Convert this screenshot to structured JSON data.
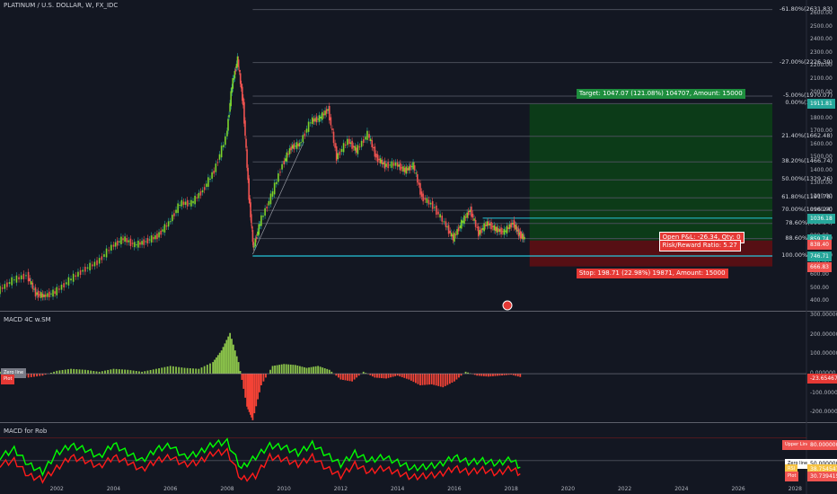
{
  "title": "PLATINUM / U.S. DOLLAR, W, FX_IDC",
  "panels": {
    "macd1_title": "MACD 4C w.SM",
    "macd2_title": "MACD for Rob"
  },
  "chart_data": [
    {
      "type": "line",
      "subtype": "candlestick",
      "title": "PLATINUM / U.S. DOLLAR, W, FX_IDC",
      "x_ticks": [
        "2002",
        "2004",
        "2006",
        "2008",
        "2010",
        "2012",
        "2014",
        "2016",
        "2018",
        "2020",
        "2022",
        "2024",
        "2026",
        "2028"
      ],
      "y_ticks": [
        300,
        400,
        500,
        600,
        700,
        800,
        900,
        1000,
        1100,
        1200,
        1300,
        1400,
        1500,
        1600,
        1700,
        1800,
        1900,
        2000,
        2100,
        2200,
        2300,
        2400,
        2500,
        2600
      ],
      "ylim": [
        300,
        2650
      ],
      "series": [
        {
          "x": [
            2000.0,
            2000.5,
            2001.0,
            2001.3,
            2001.6,
            2002.0,
            2002.5,
            2003.0,
            2003.5,
            2004.0,
            2004.4,
            2004.8,
            2005.2,
            2005.6,
            2006.0,
            2006.4,
            2006.8,
            2007.2,
            2007.6,
            2008.0,
            2008.2,
            2008.4,
            2008.6,
            2008.8,
            2008.95,
            2009.2,
            2009.6,
            2010.0,
            2010.3,
            2010.6,
            2011.0,
            2011.3,
            2011.6,
            2011.9,
            2012.3,
            2012.6,
            2013.0,
            2013.3,
            2013.6,
            2014.0,
            2014.3,
            2014.6,
            2014.9,
            2015.3,
            2015.7,
            2016.0,
            2016.3,
            2016.6,
            2016.9,
            2017.2,
            2017.5,
            2017.8,
            2018.1,
            2018.3,
            2018.5
          ],
          "values": [
            480,
            560,
            600,
            460,
            440,
            470,
            560,
            640,
            700,
            820,
            880,
            830,
            860,
            900,
            1000,
            1150,
            1150,
            1250,
            1400,
            1650,
            2050,
            2250,
            1900,
            1200,
            800,
            1000,
            1200,
            1450,
            1580,
            1600,
            1780,
            1800,
            1870,
            1500,
            1630,
            1550,
            1680,
            1500,
            1440,
            1450,
            1400,
            1440,
            1200,
            1130,
            1000,
            880,
            1000,
            1100,
            920,
            1000,
            950,
            930,
            1000,
            920,
            880
          ]
        }
      ],
      "fibonacci_levels": [
        {
          "label": "-61.80%(2631.83)",
          "value": 2631.83
        },
        {
          "label": "-27.00%(2226.39)",
          "value": 2226.39
        },
        {
          "label": "-5.00%(1970.07)",
          "value": 1970.07
        },
        {
          "label": "0.00%(1911.81)",
          "value": 1911.81
        },
        {
          "label": "21.40%(1662.48)",
          "value": 1662.48
        },
        {
          "label": "38.20%(1466.74)",
          "value": 1466.74
        },
        {
          "label": "50.00%(1329.26)",
          "value": 1329.26
        },
        {
          "label": "61.80%(1191.78)",
          "value": 1191.78
        },
        {
          "label": "70.00%(1096.24)",
          "value": 1096.24
        },
        {
          "label": "78.60%(996.04)",
          "value": 996.04
        },
        {
          "label": "88.60%(879.53)",
          "value": 879.53
        },
        {
          "label": "100.00%(746.71)",
          "value": 746.71
        }
      ],
      "position": {
        "target_label": "Target: 1047.07 (121.08%) 104707, Amount: 15000",
        "stop_label": "Stop: 198.71 (22.98%) 19871, Amount: 15000",
        "pnl_label": "Open P&L: -26.34, Qty: 0",
        "rr_label": "Risk/Reward Ratio: 5.27",
        "entry": 865,
        "target": 1911.81,
        "stop": 666.83
      },
      "price_tags": [
        {
          "text": "1911.81",
          "value": 1911.81,
          "color": "#26a69a"
        },
        {
          "text": "1036.18",
          "value": 1036.18,
          "color": "#26a69a"
        },
        {
          "text": "859.74",
          "value": 880,
          "color": "#26a69a"
        },
        {
          "text": "838.40",
          "value": 838.4,
          "color": "#ef5350"
        },
        {
          "text": "746.71",
          "value": 746.71,
          "color": "#26a69a"
        },
        {
          "text": "666.83",
          "value": 666.83,
          "color": "#ef5350"
        }
      ]
    },
    {
      "type": "bar",
      "title": "MACD 4C w.SM",
      "y_ticks": [
        {
          "label": "300.000000",
          "value": 300
        },
        {
          "label": "200.000000",
          "value": 200
        },
        {
          "label": "100.000000",
          "value": 100
        },
        {
          "label": "0.000000",
          "value": 0
        },
        {
          "label": "-100.000000",
          "value": -100
        },
        {
          "label": "-200.000000",
          "value": -200
        }
      ],
      "ylim": [
        -250,
        320
      ],
      "series": [
        {
          "name": "histogram",
          "x": [
            2000,
            2000.5,
            2001,
            2001.5,
            2002,
            2002.5,
            2003,
            2003.5,
            2004,
            2004.5,
            2005,
            2005.5,
            2006,
            2006.5,
            2007,
            2007.5,
            2007.8,
            2008.1,
            2008.4,
            2008.7,
            2008.9,
            2009.2,
            2009.6,
            2010,
            2010.4,
            2010.8,
            2011.2,
            2011.6,
            2012,
            2012.4,
            2012.8,
            2013.2,
            2013.6,
            2014,
            2014.4,
            2014.8,
            2015.2,
            2015.6,
            2016,
            2016.4,
            2016.8,
            2017.2,
            2017.6,
            2018,
            2018.4
          ],
          "values": [
            10,
            15,
            -20,
            -10,
            15,
            25,
            20,
            10,
            25,
            20,
            10,
            25,
            40,
            30,
            25,
            60,
            120,
            210,
            60,
            -170,
            -240,
            -60,
            40,
            50,
            45,
            30,
            40,
            20,
            -30,
            -40,
            10,
            -20,
            -25,
            -10,
            -30,
            -60,
            -55,
            -70,
            -40,
            10,
            -10,
            -15,
            -10,
            -5,
            -20
          ]
        }
      ],
      "zero_label": "Zero line",
      "last_label": "-23.65467",
      "legend_text": "Plot"
    },
    {
      "type": "line",
      "title": "MACD for Rob",
      "ylim": [
        20,
        100
      ],
      "hlines": [
        {
          "name": "Upper Line",
          "value": 80
        },
        {
          "name": "Zero line",
          "value": 50
        }
      ],
      "series": [
        {
          "name": "RSI",
          "x": [
            2000,
            2000.5,
            2001,
            2001.5,
            2002,
            2002.5,
            2003,
            2003.5,
            2004,
            2004.5,
            2005,
            2005.5,
            2006,
            2006.5,
            2007,
            2007.5,
            2008,
            2008.5,
            2009,
            2009.5,
            2010,
            2010.5,
            2011,
            2011.5,
            2012,
            2012.5,
            2013,
            2013.5,
            2014,
            2014.5,
            2015,
            2015.5,
            2016,
            2016.5,
            2017,
            2017.5,
            2018,
            2018.4
          ],
          "values": [
            55,
            65,
            45,
            35,
            60,
            70,
            65,
            55,
            72,
            60,
            50,
            65,
            70,
            55,
            60,
            72,
            75,
            40,
            55,
            70,
            68,
            60,
            72,
            58,
            45,
            60,
            50,
            55,
            48,
            40,
            42,
            45,
            55,
            48,
            50,
            46,
            52,
            38.75
          ]
        },
        {
          "name": "Plot",
          "x": [
            2000,
            2000.5,
            2001,
            2001.5,
            2002,
            2002.5,
            2003,
            2003.5,
            2004,
            2004.5,
            2005,
            2005.5,
            2006,
            2006.5,
            2007,
            2007.5,
            2008,
            2008.5,
            2009,
            2009.5,
            2010,
            2010.5,
            2011,
            2011.5,
            2012,
            2012.5,
            2013,
            2013.5,
            2014,
            2014.5,
            2015,
            2015.5,
            2016,
            2016.5,
            2017,
            2017.5,
            2018,
            2018.4
          ],
          "values": [
            45,
            50,
            30,
            25,
            40,
            55,
            50,
            42,
            55,
            48,
            38,
            50,
            55,
            45,
            48,
            60,
            62,
            25,
            30,
            55,
            52,
            45,
            55,
            40,
            30,
            45,
            35,
            40,
            34,
            28,
            30,
            32,
            40,
            35,
            38,
            33,
            40,
            30.74
          ]
        }
      ],
      "tags": [
        {
          "text": "Upper Line",
          "value_text": "80.000000",
          "color": "#ef5350"
        },
        {
          "text": "Zero line",
          "value_text": "50.000000",
          "color": "#ffffff"
        },
        {
          "text": "RSI",
          "value_text": "38.754547",
          "color": "#f6c343"
        },
        {
          "text": "Plot",
          "value_text": "30.739415",
          "color": "#ef5350"
        }
      ]
    }
  ],
  "colors": {
    "background": "#131722",
    "up": "#26a69a",
    "down": "#ef5350",
    "macd_pos": "#8bc34a",
    "macd_neg": "#f44336",
    "fib_line": "#4a4e5a",
    "rsi": "#00ff00",
    "signal": "#ff1a1a"
  }
}
